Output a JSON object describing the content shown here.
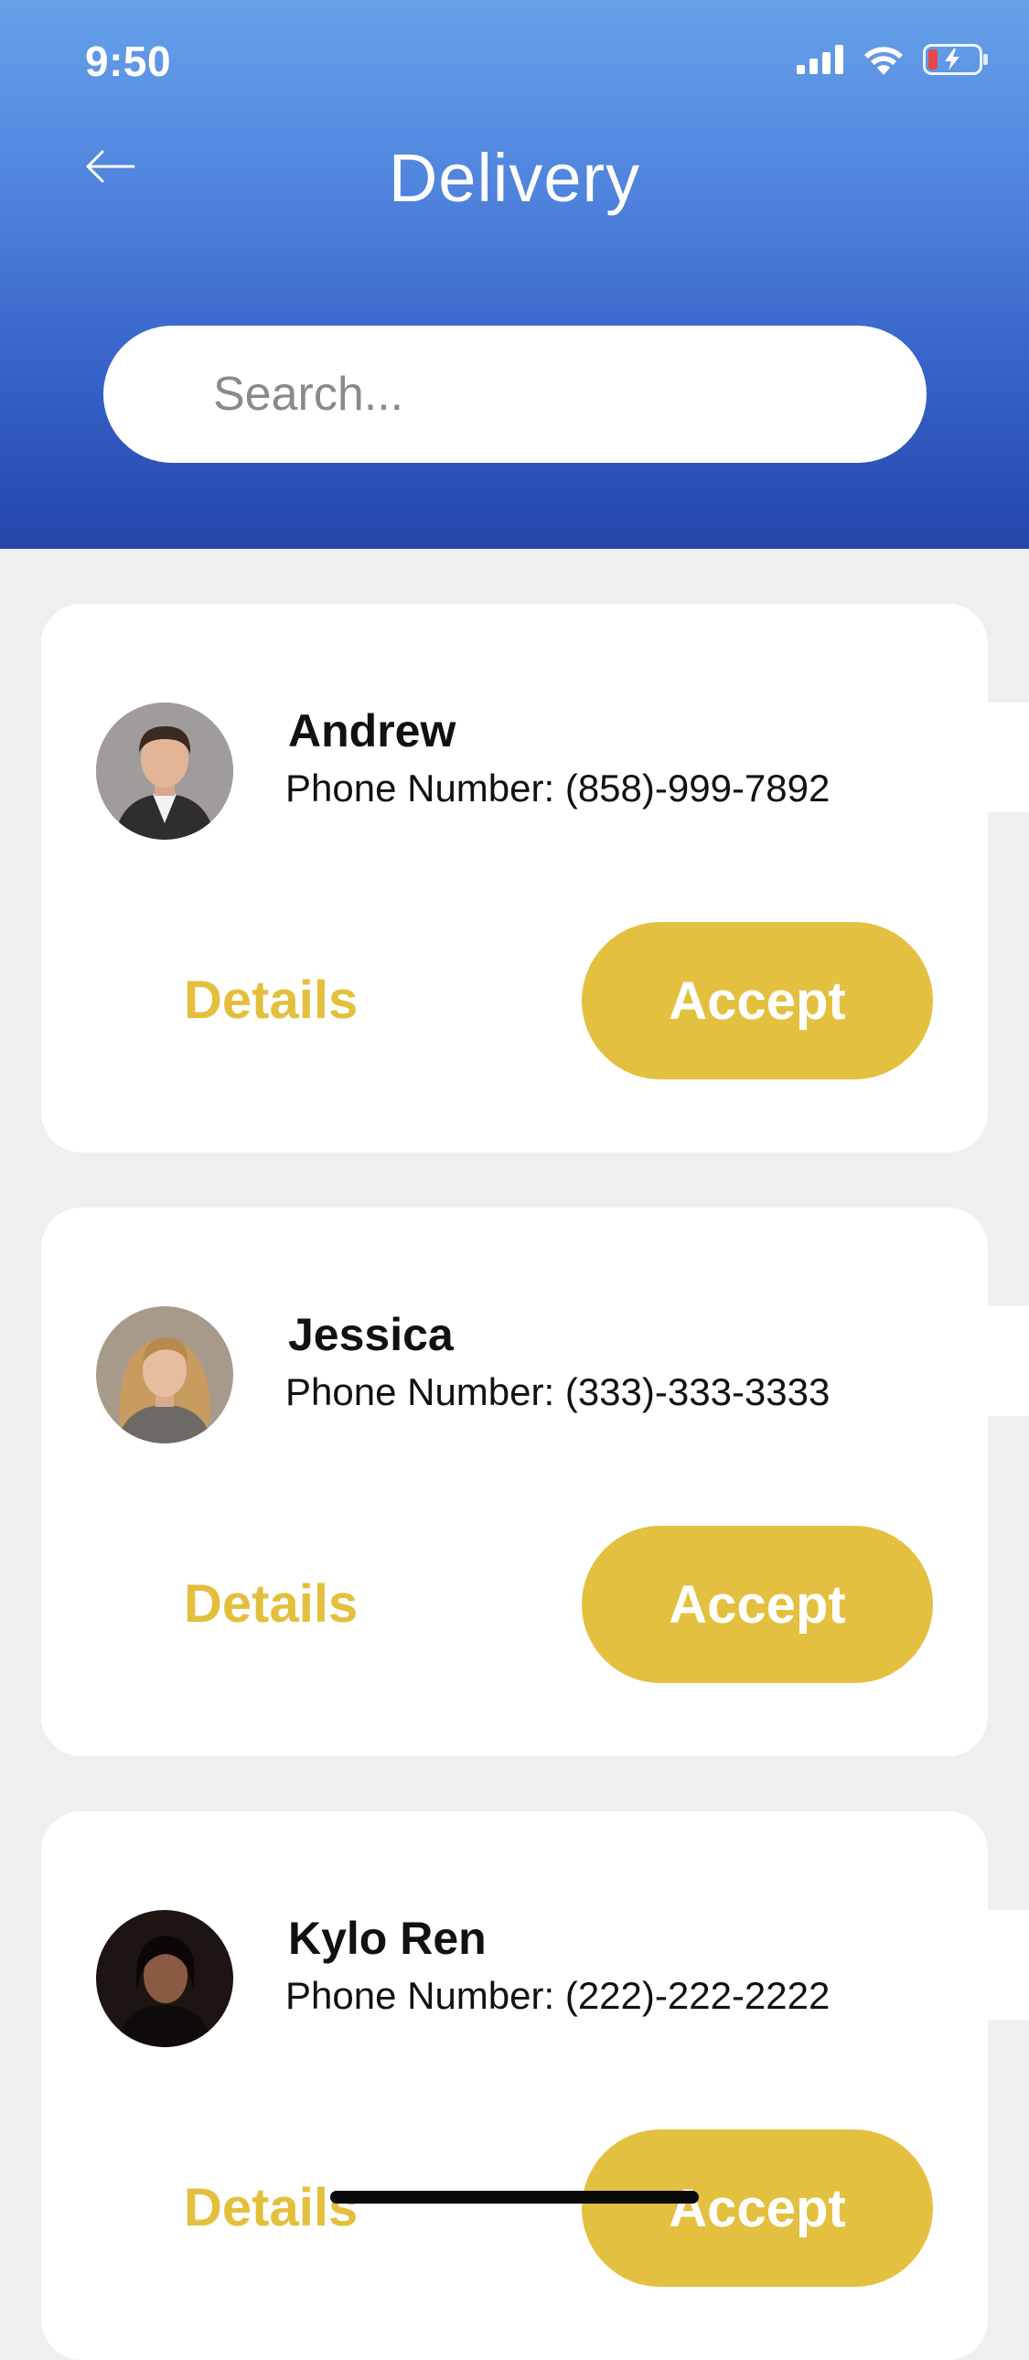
{
  "status_bar": {
    "time": "9:50",
    "icons": [
      "cellular-signal-icon",
      "wifi-icon",
      "battery-charging-icon"
    ]
  },
  "header": {
    "title": "Delivery",
    "back_icon": "arrow-left-icon"
  },
  "search": {
    "placeholder": "Search...",
    "value": ""
  },
  "colors": {
    "header_gradient_top": "#66a1e9",
    "header_gradient_bottom": "#2446ab",
    "accent": "#e3c03f",
    "background": "#efefef",
    "card": "#ffffff"
  },
  "deliveries": [
    {
      "name": "Andrew",
      "phone": "Phone Number: (858)-999-7892",
      "details_label": "Details",
      "accept_label": "Accept"
    },
    {
      "name": "Jessica",
      "phone": "Phone Number: (333)-333-3333",
      "details_label": "Details",
      "accept_label": "Accept"
    },
    {
      "name": "Kylo Ren",
      "phone": "Phone Number: (222)-222-2222",
      "details_label": "Details",
      "accept_label": "Accept"
    }
  ]
}
